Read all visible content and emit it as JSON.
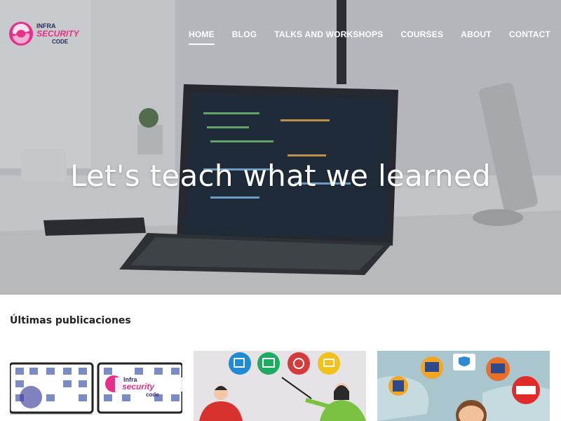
{
  "header": {
    "logo": {
      "line1": "INFRA",
      "line2": "SECURITY",
      "line3": "CODE"
    },
    "nav": [
      {
        "label": "HOME",
        "active": true
      },
      {
        "label": "BLOG",
        "active": false
      },
      {
        "label": "TALKS AND WORKSHOPS",
        "active": false
      },
      {
        "label": "COURSES",
        "active": false
      },
      {
        "label": "ABOUT",
        "active": false
      },
      {
        "label": "CONTACT",
        "active": false
      }
    ]
  },
  "hero": {
    "title": "Let's teach what we learned"
  },
  "latest": {
    "title": "Últimas publicaciones",
    "cards": [
      {
        "thumbnail_logo": {
          "line1": "Infra",
          "line2": "security",
          "line3": "code"
        }
      },
      {
        "thumbnail": "people-presenting-icons"
      },
      {
        "thumbnail": "world-map-security-icons"
      }
    ]
  },
  "colors": {
    "brand_pink": "#e6308a",
    "brand_purple": "#3b2a7a",
    "accent_gray": "#c9cbcf"
  }
}
